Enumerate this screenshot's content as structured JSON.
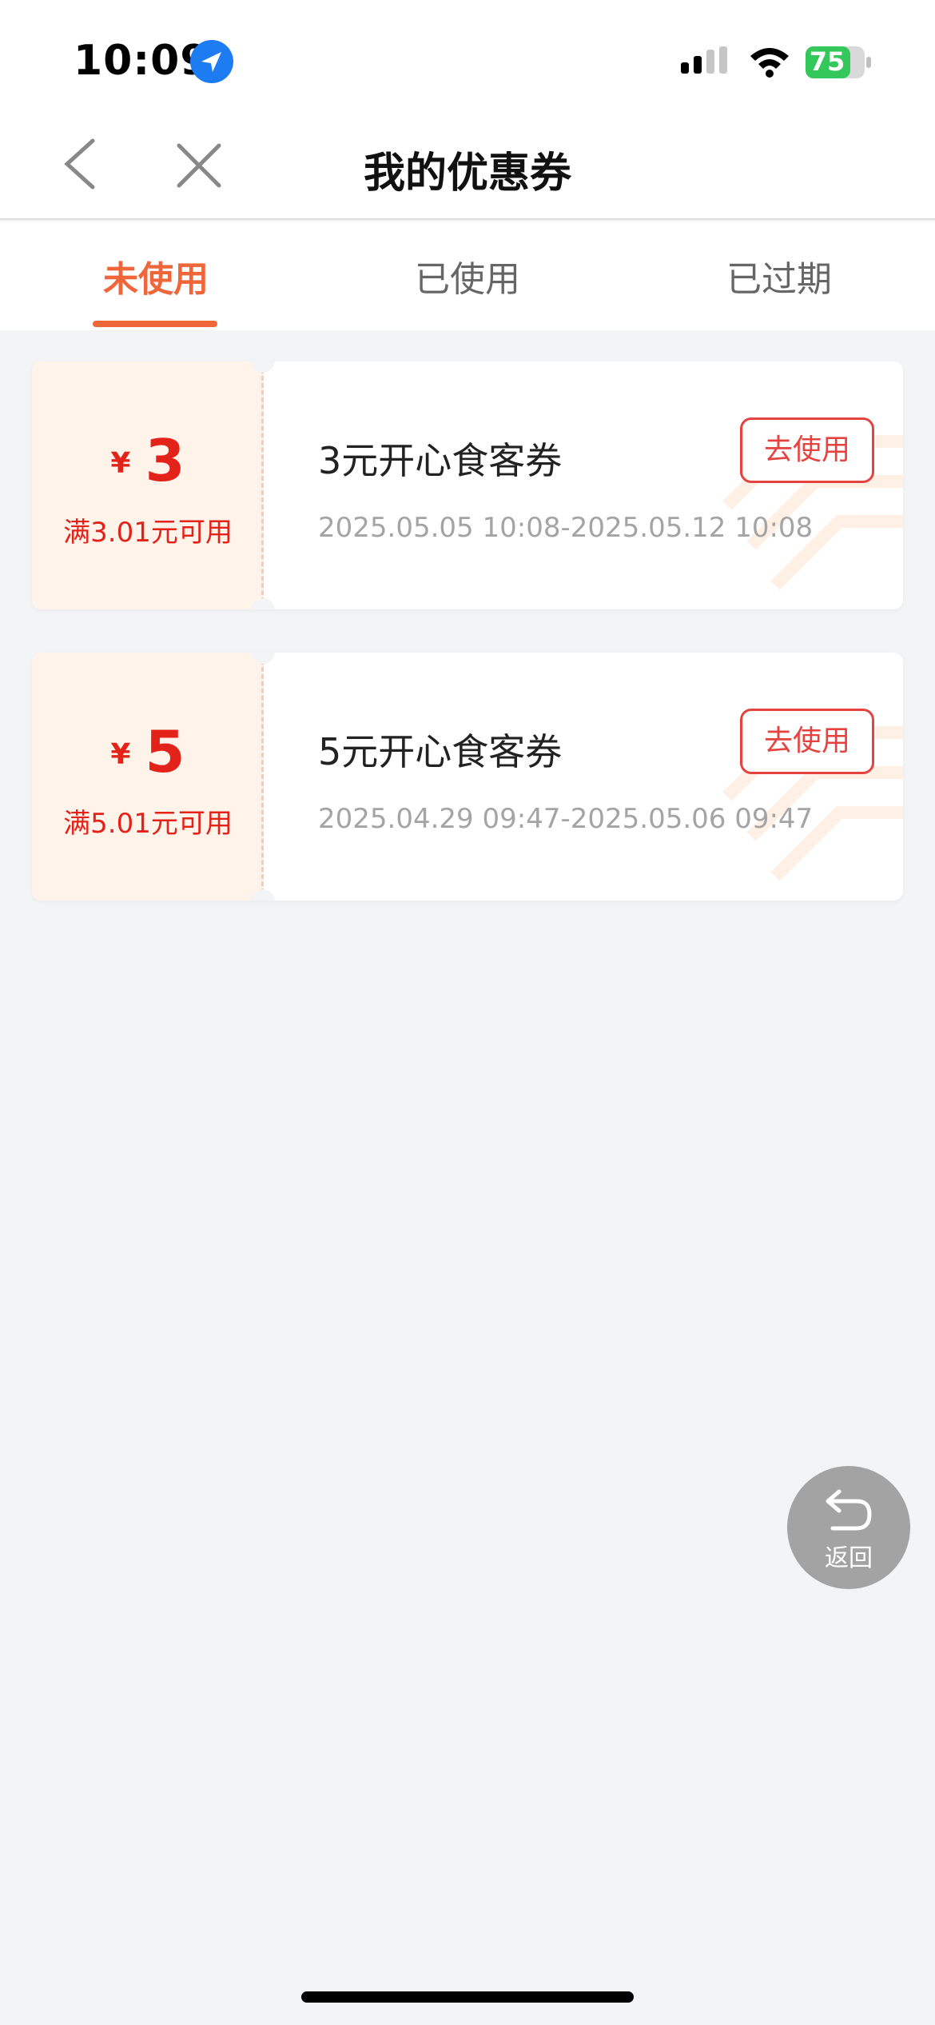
{
  "status_bar": {
    "time": "10:09",
    "battery": "75",
    "icons": [
      "location-arrow-icon",
      "cellular-signal-icon",
      "wifi-icon",
      "battery-charging-icon"
    ]
  },
  "nav": {
    "title": "我的优惠券",
    "icons": [
      "back-chevron-icon",
      "close-icon"
    ]
  },
  "tabs": [
    {
      "label": "未使用",
      "active": true
    },
    {
      "label": "已使用",
      "active": false
    },
    {
      "label": "已过期",
      "active": false
    }
  ],
  "coupons": [
    {
      "currency": "¥",
      "amount": "3",
      "threshold": "满3.01元可用",
      "name": "3元开心食客券",
      "validity": "2025.05.05 10:08-2025.05.12 10:08",
      "button": "去使用"
    },
    {
      "currency": "¥",
      "amount": "5",
      "threshold": "满5.01元可用",
      "name": "5元开心食客券",
      "validity": "2025.04.29 09:47-2025.05.06 09:47",
      "button": "去使用"
    }
  ],
  "return_button": {
    "label": "返回",
    "icon": "return-arrow-icon"
  },
  "colors": {
    "accent": "#f0663b",
    "coupon_red": "#e3231a",
    "button_red": "#e64340",
    "background": "#f3f4f6",
    "coupon_left_bg": "#fff3ea",
    "return_bg": "#a3a3a3"
  }
}
